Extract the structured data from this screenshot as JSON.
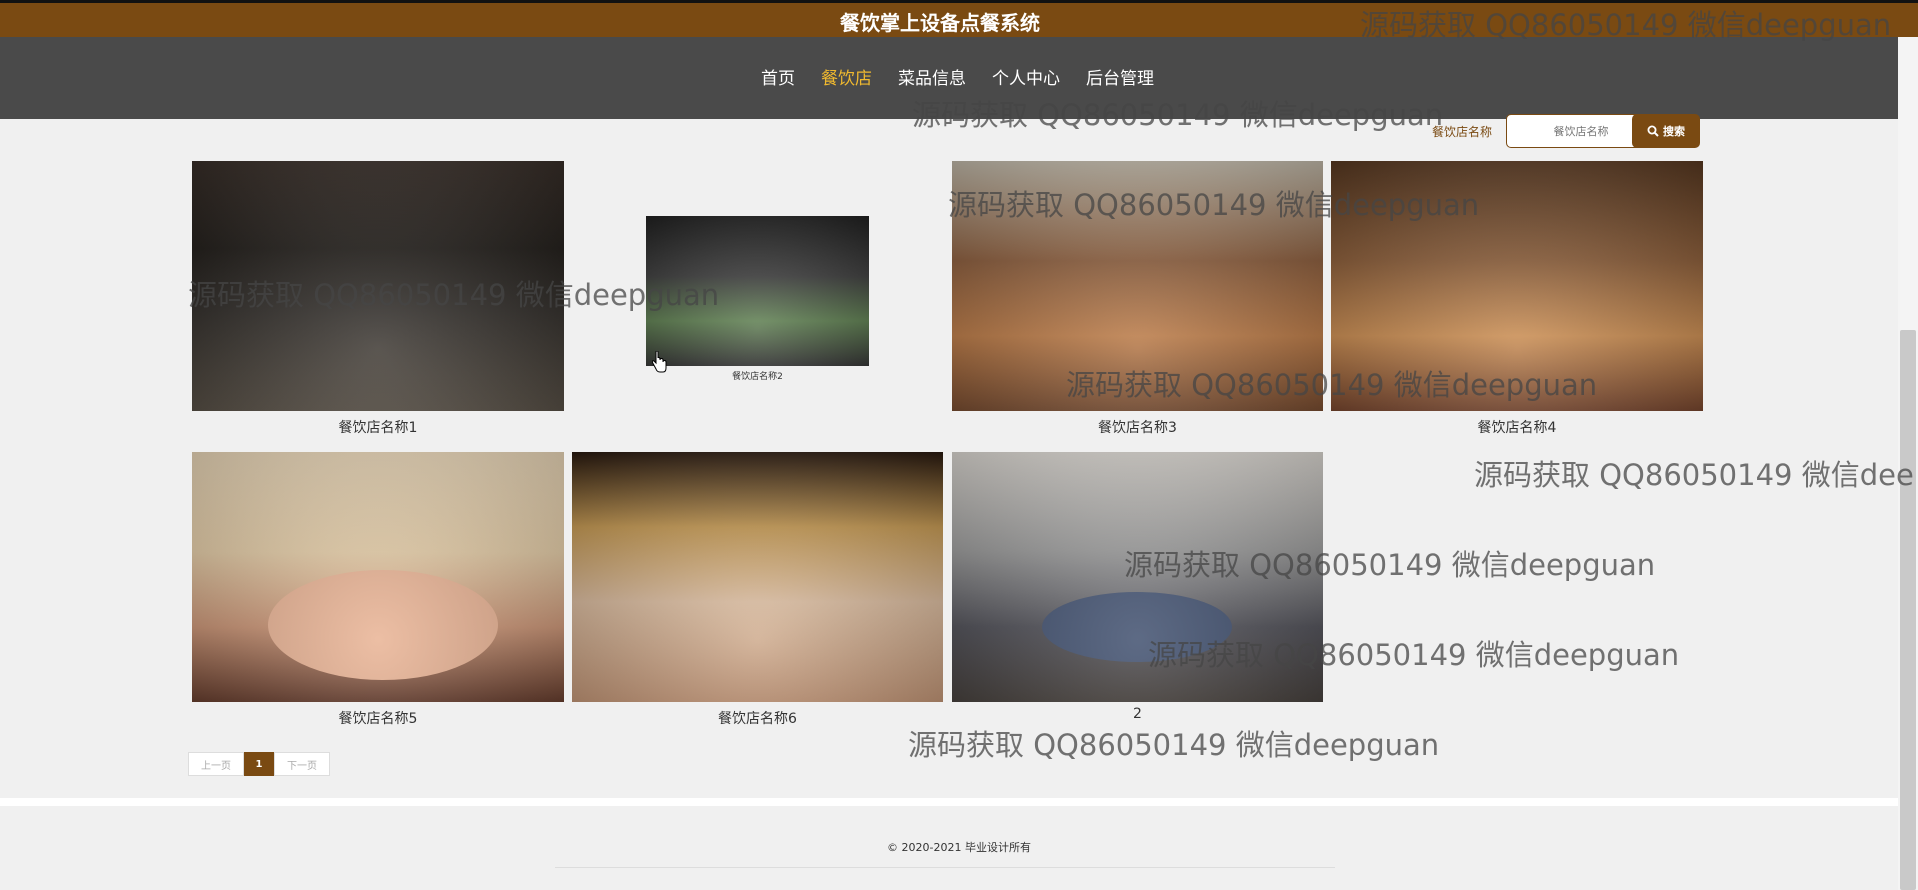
{
  "header": {
    "title": "餐饮掌上设备点餐系统"
  },
  "nav": {
    "items": [
      {
        "label": "首页",
        "active": false
      },
      {
        "label": "餐饮店",
        "active": true
      },
      {
        "label": "菜品信息",
        "active": false
      },
      {
        "label": "个人中心",
        "active": false
      },
      {
        "label": "后台管理",
        "active": false
      }
    ]
  },
  "search": {
    "label": "餐饮店名称",
    "placeholder": "餐饮店名称",
    "button_label": "搜索"
  },
  "restaurants": [
    {
      "name": "餐饮店名称1"
    },
    {
      "name": "餐饮店名称2"
    },
    {
      "name": "餐饮店名称3"
    },
    {
      "name": "餐饮店名称4"
    },
    {
      "name": "餐饮店名称5"
    },
    {
      "name": "餐饮店名称6"
    },
    {
      "name": "2"
    }
  ],
  "pagination": {
    "prev_label": "上一页",
    "current_page": "1",
    "next_label": "下一页"
  },
  "footer": {
    "copyright": "© 2020-2021 毕业设计所有"
  },
  "watermarks": [
    "源码获取 QQ86050149 微信deepguan",
    "源码获取 QQ86050149 微信deepguan",
    "源码获取 QQ86050149 微信deepguan",
    "源码获取 QQ86050149 微信deepguan",
    "源码获取 QQ86050149 微信deepguan",
    "源码获取 QQ86050149 微信dee",
    "源码获取 QQ86050149 微信deepguan",
    "源码获取 QQ86050149 微信deepguan",
    "源码获取 QQ86050149 微信deepguan"
  ],
  "colors": {
    "brand": "#7a4a12",
    "nav_bg": "#4a4a4a",
    "nav_active": "#f0b92f",
    "page_bg": "#f0f0f0"
  }
}
